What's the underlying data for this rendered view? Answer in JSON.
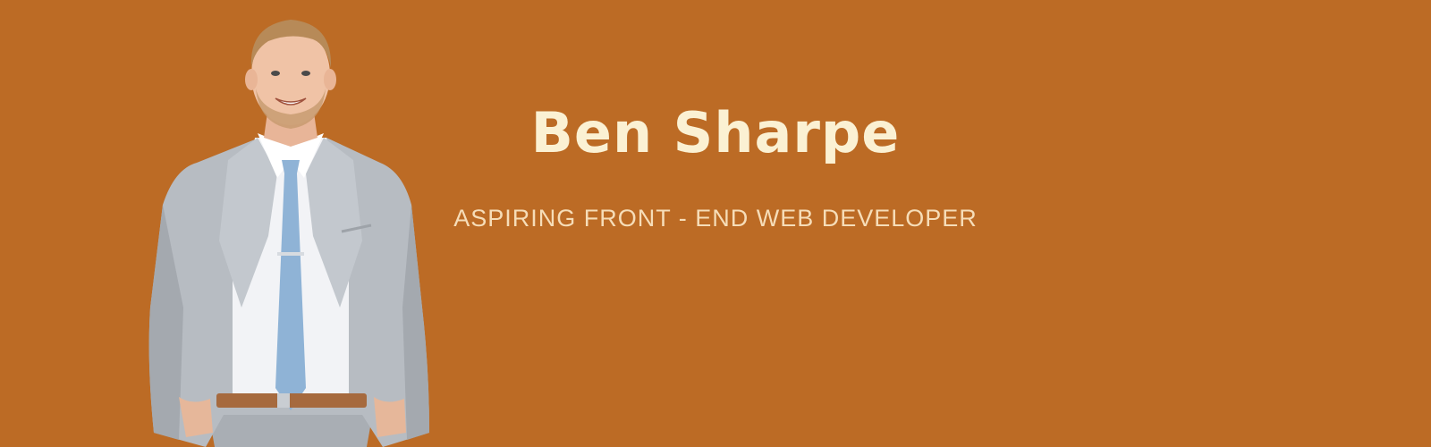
{
  "hero": {
    "name": "Ben Sharpe",
    "tagline": "ASPIRING FRONT - END WEB DEVELOPER",
    "portrait_icon": "person-in-suit-photo"
  },
  "colors": {
    "background": "#bc6b25",
    "name_text": "#fbf1d3",
    "tagline_text": "#f6ddb8",
    "suit": "#b7bcc2",
    "tie": "#8fb3d6"
  }
}
